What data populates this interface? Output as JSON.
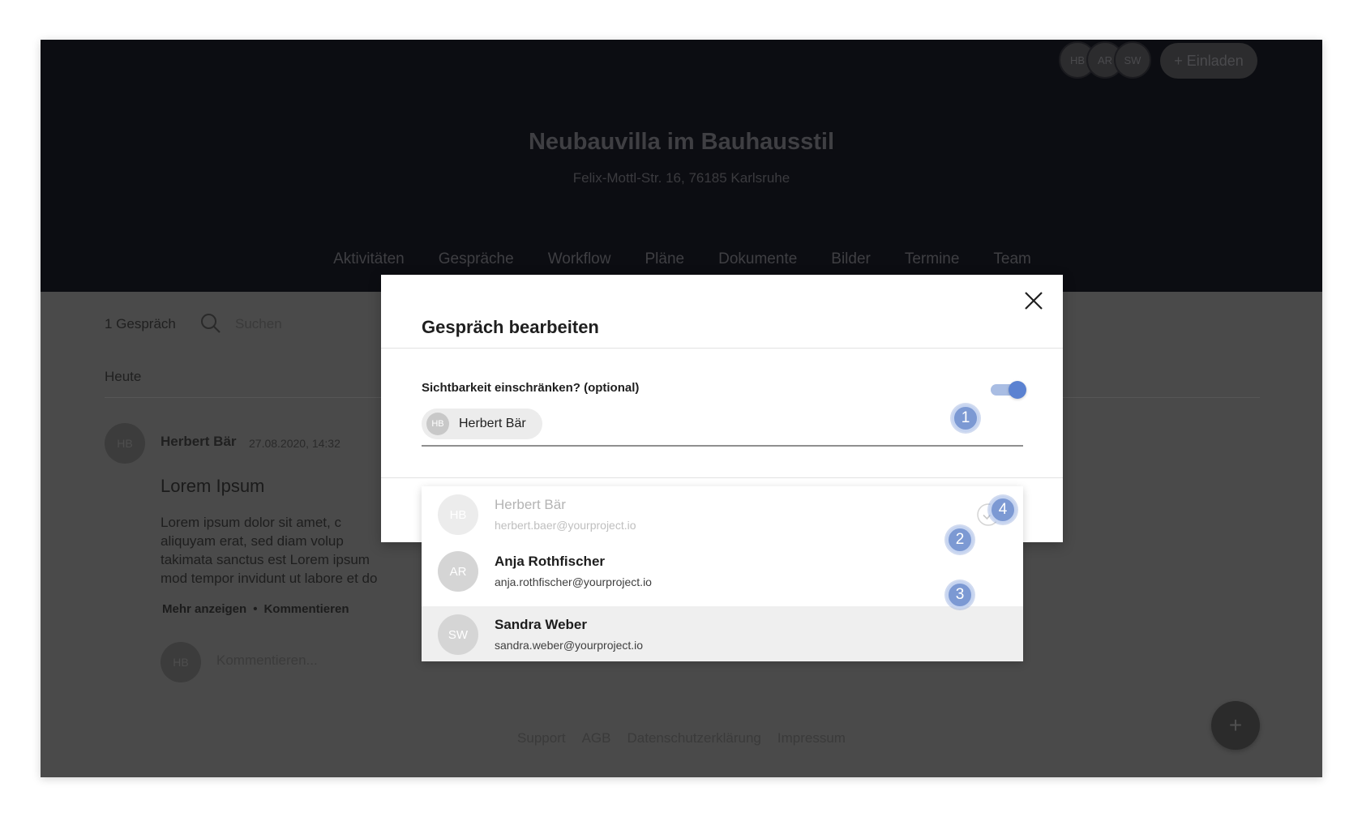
{
  "header": {
    "avatars": [
      "HB",
      "AR",
      "SW"
    ],
    "invite_label": "+ Einladen",
    "project_title": "Neubauvilla im Bauhausstil",
    "project_address": "Felix-Mottl-Str. 16, 76185 Karlsruhe",
    "nav": [
      "Aktivitäten",
      "Gespräche",
      "Workflow",
      "Pläne",
      "Dokumente",
      "Bilder",
      "Termine",
      "Team"
    ]
  },
  "content": {
    "conversation_count": "1 Gespräch",
    "search_placeholder": "Suchen",
    "section_today": "Heute",
    "post": {
      "avatar": "HB",
      "author": "Herbert Bär",
      "date": "27.08.2020, 14:32",
      "title": "Lorem Ipsum",
      "body": [
        "Lorem ipsum dolor sit amet, c",
        "aliquyam erat, sed diam volup",
        "takimata sanctus est Lorem ipsum",
        "mod tempor invidunt ut labore et do"
      ],
      "show_more": "Mehr anzeigen",
      "separator": "•",
      "comment_action": "Kommentieren"
    },
    "comment_avatar": "HB",
    "comment_placeholder": "Kommentieren..."
  },
  "footer": {
    "links": [
      "Support",
      "AGB",
      "Datenschutzerklärung",
      "Impressum"
    ],
    "fab_label": "+"
  },
  "modal": {
    "title": "Gespräch bearbeiten",
    "restrict_label": "Sichtbarkeit einschränken? (optional)",
    "toggle_on": true,
    "chip": {
      "initials": "HB",
      "name": "Herbert Bär"
    }
  },
  "dropdown": {
    "items": [
      {
        "initials": "HB",
        "name": "Herbert Bär",
        "email": "herbert.baer@yourproject.io",
        "selected": true
      },
      {
        "initials": "AR",
        "name": "Anja Rothfischer",
        "email": "anja.rothfischer@yourproject.io"
      },
      {
        "initials": "SW",
        "name": "Sandra Weber",
        "email": "sandra.weber@yourproject.io"
      }
    ]
  },
  "markers": [
    "1",
    "2",
    "3",
    "4"
  ],
  "colors": {
    "accent": "#5b82d1",
    "marker": "#7c99d3",
    "header_bg": "#0c0d12",
    "overlay_bg": "#4a4a4a"
  }
}
